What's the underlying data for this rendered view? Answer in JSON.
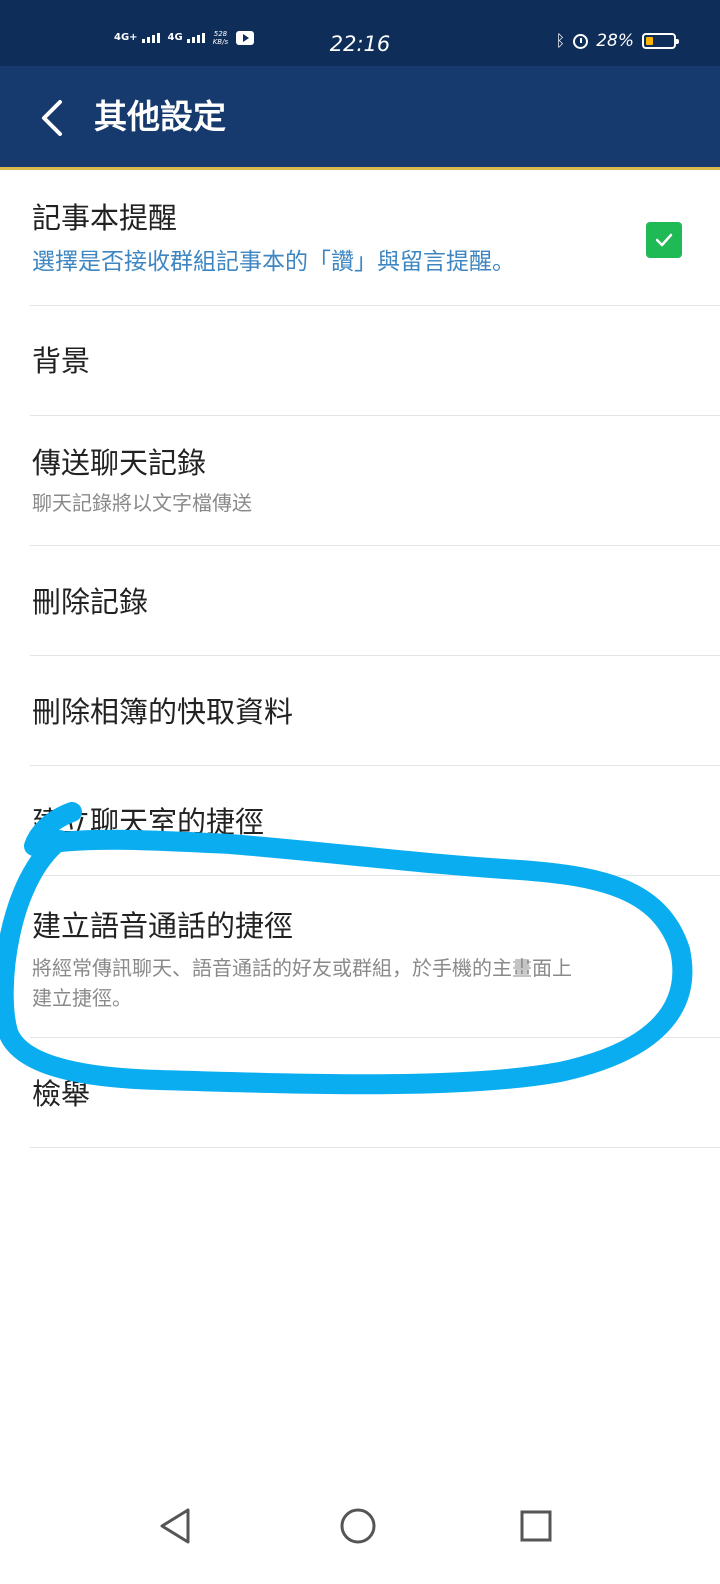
{
  "status_bar": {
    "time": "22:16",
    "network_1": "4G+",
    "network_2": "4G",
    "speed_value": "528",
    "speed_unit": "KB/s",
    "battery_percent": "28%",
    "battery_level": 0.28,
    "icons": [
      "youtube-icon",
      "bluetooth-icon",
      "alarm-icon",
      "battery-icon"
    ]
  },
  "header": {
    "title": "其他設定",
    "back_icon": "chevron-left-icon"
  },
  "settings": [
    {
      "title": "記事本提醒",
      "subtitle": "選擇是否接收群組記事本的「讚」與留言提醒。",
      "checked": true
    },
    {
      "title": "背景"
    },
    {
      "title": "傳送聊天記錄",
      "subtitle": "聊天記錄將以文字檔傳送"
    },
    {
      "title": "刪除記錄"
    },
    {
      "title": "刪除相簿的快取資料"
    },
    {
      "title": "建立聊天室的捷徑"
    },
    {
      "title": "建立語音通話的捷徑",
      "subtitle_line1": "將經常傳訊聊天、語音通話的好友或群組，於手機的主畫面上",
      "subtitle_line2": "建立捷徑。"
    },
    {
      "title": "檢舉"
    }
  ],
  "colors": {
    "status_bar": "#0e2d58",
    "header": "#163a6e",
    "header_accent": "#d8b94a",
    "checkbox": "#1fb955",
    "subtitle_blue": "#3e86c2",
    "annotation": "#0aaef0"
  },
  "nav_bar": {
    "icons": [
      "back-triangle-icon",
      "home-circle-icon",
      "recents-square-icon"
    ]
  }
}
